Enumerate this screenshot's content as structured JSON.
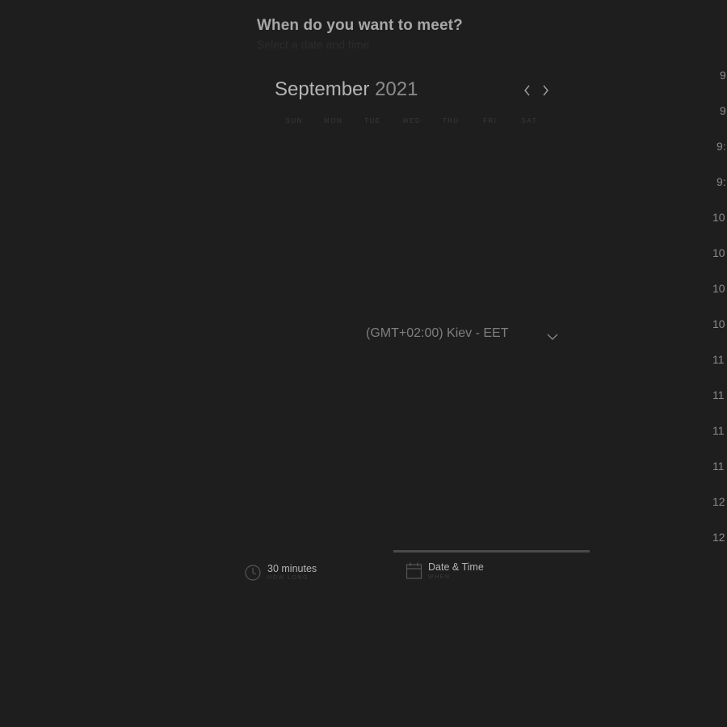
{
  "header": {
    "title": "When do you want to meet?",
    "subtitle": "Select a date and time"
  },
  "calendar": {
    "month": "September",
    "year": "2021",
    "prev_icon": "chevron-left-icon",
    "next_icon": "chevron-right-icon",
    "weekdays": [
      "SUN",
      "MON",
      "TUE",
      "WED",
      "THU",
      "FRI",
      "SAT"
    ]
  },
  "timezone": {
    "selected": "(GMT+02:00) Kiev - EET",
    "icon": "chevron-down-icon"
  },
  "time_slots": [
    "9",
    "9",
    "9:",
    "9:",
    "10",
    "10",
    "10",
    "10",
    "11",
    "11",
    "11",
    "11",
    "12",
    "12"
  ],
  "steps": {
    "duration": {
      "title": "30 minutes",
      "subtitle": "HOW LONG",
      "icon": "clock-icon"
    },
    "datetime": {
      "title": "Date & Time",
      "subtitle": "WHEN",
      "icon": "calendar-icon"
    }
  },
  "colors": {
    "background": "#1e1e1e",
    "progress": "#4a4a4a"
  }
}
